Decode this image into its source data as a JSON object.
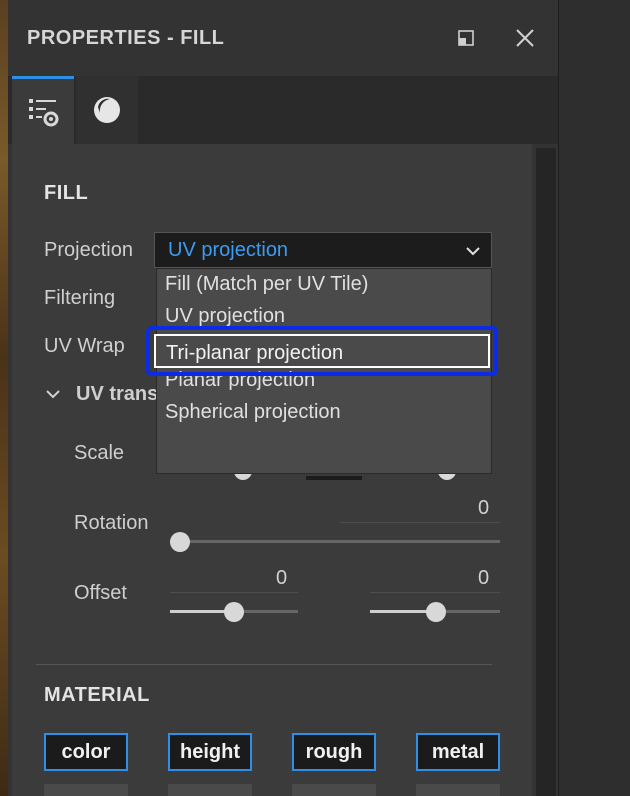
{
  "panel": {
    "title": "PROPERTIES - FILL",
    "window_buttons": {
      "restore_icon": "restore-icon",
      "close_icon": "close-icon"
    },
    "tabs": [
      {
        "icon": "layer-settings-icon",
        "active": true
      },
      {
        "icon": "material-sphere-icon",
        "active": false
      }
    ]
  },
  "fill": {
    "section_title": "FILL",
    "projection_label": "Projection",
    "projection_value": "UV projection",
    "filtering_label": "Filtering",
    "uv_wrap_label": "UV Wrap",
    "uv_transform_label": "UV trans",
    "projection_options": [
      "Fill (Match per UV Tile)",
      "UV projection",
      "Tri-planar projection",
      "Planar projection",
      "Spherical projection"
    ],
    "highlighted_option": "Tri-planar projection"
  },
  "uv_transform": {
    "scale_label": "Scale",
    "rotation_label": "Rotation",
    "rotation_value": "0",
    "offset_label": "Offset",
    "offset_u_value": "0",
    "offset_v_value": "0"
  },
  "material": {
    "section_title": "MATERIAL",
    "channels": [
      "color",
      "height",
      "rough",
      "metal"
    ]
  },
  "colors": {
    "accent": "#2f8fe6",
    "highlight_border": "#0b2be8",
    "selected_text": "#3d9bf0"
  }
}
